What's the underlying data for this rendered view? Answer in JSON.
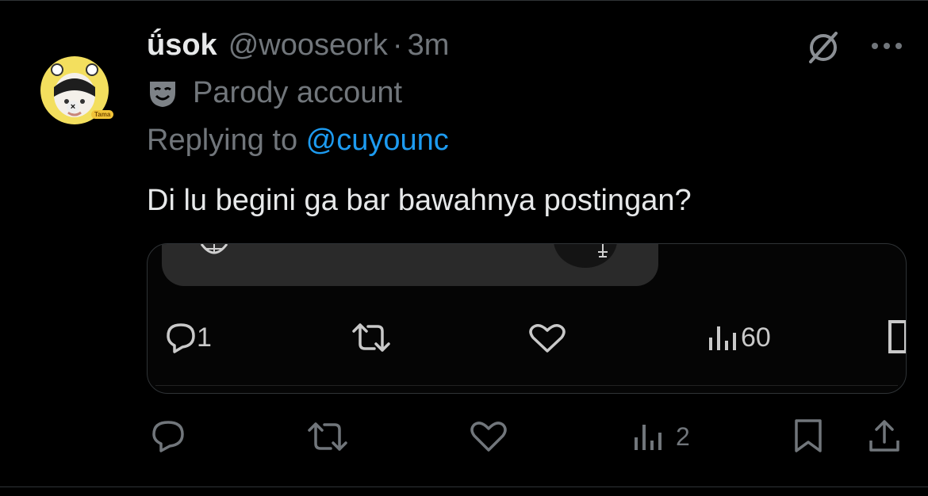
{
  "tweet": {
    "display_name": "ǘsok",
    "handle": "@wooseork",
    "separator": "·",
    "time": "3m",
    "parody_label": "Parody account",
    "replying_prefix": "Replying to ",
    "replying_to": "@cuyounc",
    "text": "Di lu begini ga bar bawahnya postingan?",
    "avatar_tag": "Tama"
  },
  "embedded_screenshot": {
    "reply_count": "1",
    "view_count": "60"
  },
  "actions": {
    "reply_count": "",
    "view_count": "2"
  },
  "colors": {
    "background": "#000000",
    "text_primary": "#e7e9ea",
    "text_secondary": "#71767b",
    "accent": "#1d9bf0"
  },
  "icons": [
    "grok-icon",
    "more-icon",
    "parody-mask-icon",
    "reply-icon",
    "retweet-icon",
    "like-icon",
    "views-icon",
    "bookmark-icon",
    "share-icon"
  ]
}
